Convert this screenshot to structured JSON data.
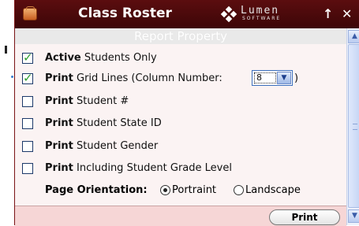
{
  "window": {
    "title": "Class Roster",
    "logo_text": "Lumen",
    "logo_sub": "SOFTWARE",
    "up_glyph": "↑",
    "close_glyph": "✕"
  },
  "panel": {
    "header": "Report Property"
  },
  "options": [
    {
      "bold": "Active",
      "text": " Students Only",
      "checked": true
    },
    {
      "bold": "Print",
      "text": " Grid Lines (Column Number:",
      "checked": true
    },
    {
      "bold": "Print",
      "text": " Student #",
      "checked": false
    },
    {
      "bold": "Print",
      "text": " Student State ID",
      "checked": false
    },
    {
      "bold": "Print",
      "text": " Student Gender",
      "checked": false
    },
    {
      "bold": "Print",
      "text": " Including Student Grade Level",
      "checked": false
    }
  ],
  "column_number": {
    "value": "8",
    "suffix": ")"
  },
  "orientation": {
    "label": "Page Orientation:",
    "options": [
      "Portraint",
      "Landscape"
    ],
    "selected": "Portraint"
  },
  "footer": {
    "print_label": "Print"
  },
  "colors": {
    "titlebar": "#4a0a0c",
    "panel_bg": "#fbf3f3",
    "footer_bg": "#f6d6d6",
    "check": "#2e9e2e"
  }
}
